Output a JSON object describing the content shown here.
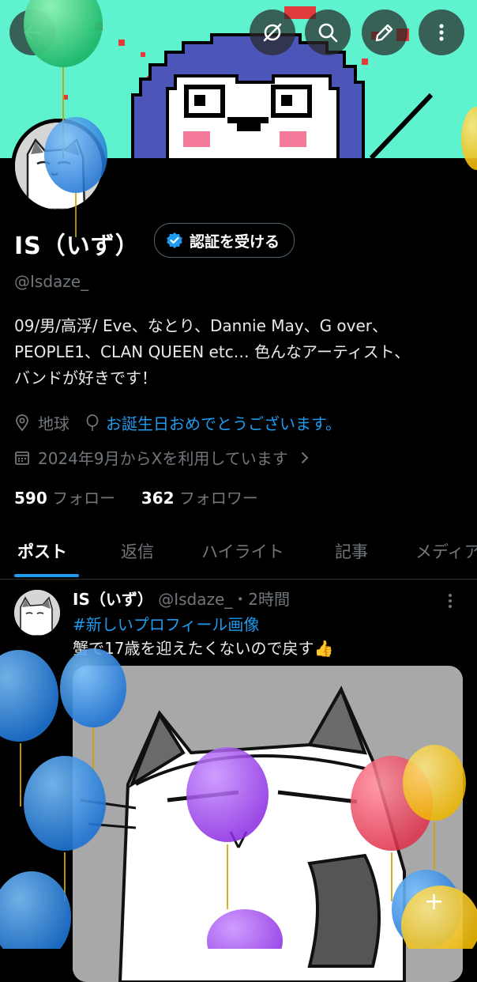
{
  "profile": {
    "name": "IS（いず）",
    "verify_label": "認証を受ける",
    "handle": "@Isdaze_",
    "bio_lines": [
      "09/男/高浮/ Eve、なとり、Dannie May、G over、",
      "PEOPLE1、CLAN QUEEN etc… 色んなアーティスト、",
      "バンドが好きです！"
    ],
    "location": "地球",
    "birthday_link": "お誕生日おめでとうございます。",
    "joined": "2024年9月からXを利用しています",
    "following_count": "590",
    "following_label": "フォロー",
    "followers_count": "362",
    "followers_label": "フォロワー"
  },
  "toolbar": {
    "icons": [
      "back-arrow-icon",
      "grok-icon",
      "search-icon",
      "edit-icon",
      "more-vertical-icon"
    ]
  },
  "tabs": [
    "ポスト",
    "返信",
    "ハイライト",
    "記事",
    "メディア"
  ],
  "post": {
    "name": "IS（いず）",
    "handle": "@Isdaze_",
    "time": "・2時間",
    "hashtag": "#新しいプロフィール画像",
    "text": "蟹で17歳を迎えたくないので戻す👍"
  },
  "colors": {
    "banner_bg": "#5ff2cf",
    "accent": "#1d9bf0",
    "text_secondary": "#71767b"
  }
}
